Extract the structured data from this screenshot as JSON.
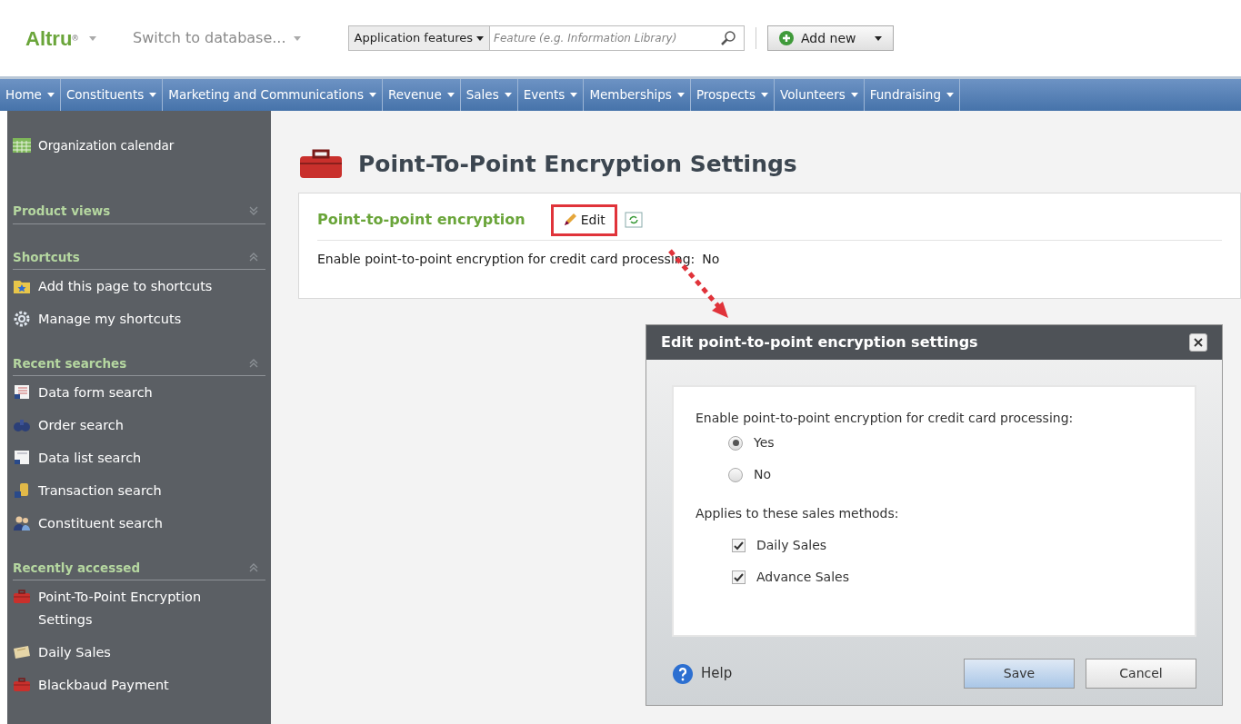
{
  "header": {
    "logo": "Altru",
    "logo_mark": "®",
    "database_switch": {
      "label": "Switch to database...",
      "disabled": true
    },
    "search_scope": "Application features",
    "search": {
      "placeholder": "Feature (e.g. Information Library)"
    },
    "add_new": "Add new"
  },
  "nav": [
    "Home",
    "Constituents",
    "Marketing and Communications",
    "Revenue",
    "Sales",
    "Events",
    "Memberships",
    "Prospects",
    "Volunteers",
    "Fundraising"
  ],
  "sidebar": {
    "top_item": "Organization calendar",
    "sections": [
      {
        "title": "Product views",
        "expanded": false
      },
      {
        "title": "Shortcuts",
        "expanded": true,
        "items": [
          "Add this page to shortcuts",
          "Manage my shortcuts"
        ]
      },
      {
        "title": "Recent searches",
        "expanded": true,
        "items": [
          "Data form search",
          "Order search",
          "Data list search",
          "Transaction search",
          "Constituent search"
        ]
      },
      {
        "title": "Recently accessed",
        "expanded": true,
        "items": [
          "Point-To-Point Encryption Settings",
          "Daily Sales",
          "Blackbaud Payment"
        ]
      }
    ]
  },
  "page": {
    "title": "Point-To-Point Encryption Settings",
    "section": {
      "title": "Point-to-point encryption",
      "edit": "Edit",
      "field_label": "Enable point-to-point encryption for credit card processing:",
      "field_value": "No"
    }
  },
  "dialog": {
    "title": "Edit point-to-point encryption settings",
    "question": "Enable point-to-point encryption for credit card processing:",
    "options": [
      {
        "label": "Yes",
        "selected": true
      },
      {
        "label": "No",
        "selected": false
      }
    ],
    "methods_label": "Applies to these sales methods:",
    "methods": [
      {
        "label": "Daily Sales",
        "checked": true
      },
      {
        "label": "Advance Sales",
        "checked": true
      }
    ],
    "help": "Help",
    "buttons": [
      {
        "label": "Save",
        "primary": true
      },
      {
        "label": "Cancel",
        "primary": false
      }
    ]
  }
}
